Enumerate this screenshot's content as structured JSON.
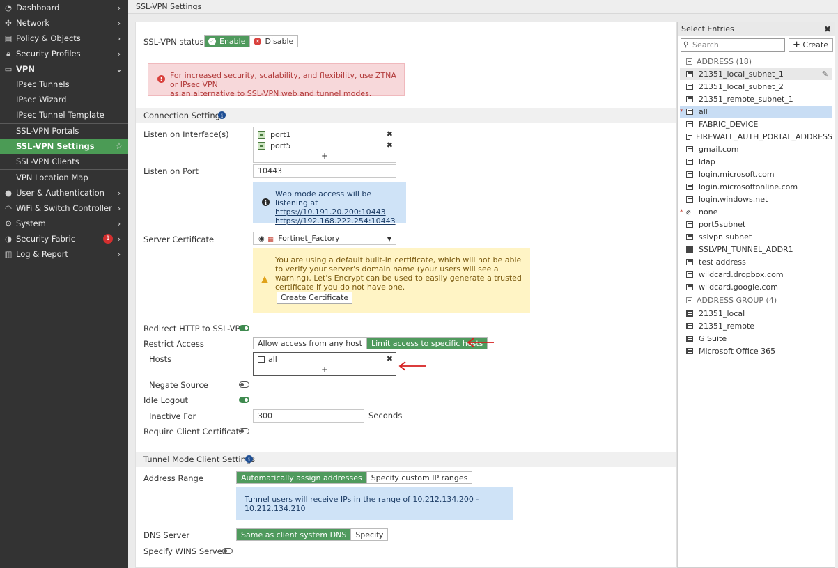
{
  "sidebar": {
    "items": [
      {
        "label": "Dashboard",
        "icon": "dashboard-icon",
        "chev": "›"
      },
      {
        "label": "Network",
        "icon": "network-icon",
        "chev": "›"
      },
      {
        "label": "Policy & Objects",
        "icon": "policy-icon",
        "chev": "›"
      },
      {
        "label": "Security Profiles",
        "icon": "lock-icon",
        "chev": "›"
      },
      {
        "label": "VPN",
        "icon": "laptop-icon",
        "chev": "⌄"
      },
      {
        "label": "User & Authentication",
        "icon": "user-icon",
        "chev": "›"
      },
      {
        "label": "WiFi & Switch Controller",
        "icon": "wifi-icon",
        "chev": "›"
      },
      {
        "label": "System",
        "icon": "gear-icon",
        "chev": "›"
      },
      {
        "label": "Security Fabric",
        "icon": "fabric-icon",
        "chev": "›",
        "badge": "1"
      },
      {
        "label": "Log & Report",
        "icon": "chart-icon",
        "chev": "›"
      }
    ],
    "vpn_sub": [
      "IPsec Tunnels",
      "IPsec Wizard",
      "IPsec Tunnel Template",
      "SSL-VPN Portals",
      "SSL-VPN Settings",
      "SSL-VPN Clients",
      "VPN Location Map"
    ]
  },
  "topbar": {
    "title": "SSL-VPN Settings"
  },
  "status": {
    "label": "SSL-VPN status",
    "enable": "Enable",
    "disable": "Disable"
  },
  "alert": {
    "pre": "For increased security, scalability, and flexibility, use ",
    "ztna": "ZTNA",
    "or": " or ",
    "ipsec": "IPsec VPN",
    "post": "as an alternative to SSL-VPN web and tunnel modes."
  },
  "connection": {
    "title": "Connection Settings",
    "listen_iface_label": "Listen on Interface(s)",
    "ports": [
      "port1",
      "port5"
    ],
    "listen_port_label": "Listen on Port",
    "listen_port_value": "10443",
    "web_info": "Web mode access will be listening at",
    "url1": "https://10.191.20.200:10443",
    "url2": "https://192.168.222.254:10443",
    "server_cert_label": "Server Certificate",
    "server_cert_value": "Fortinet_Factory",
    "cert_warning": "You are using a default built-in certificate, which will not be able to verify your server's domain name (your users will see a warning). Let's Encrypt can be used to easily generate a trusted certificate if you do not have one.",
    "create_cert": "Create Certificate",
    "redirect_label": "Redirect HTTP to SSL-VPN",
    "restrict_label": "Restrict Access",
    "restrict_any": "Allow access from any host",
    "restrict_specific": "Limit access to specific hosts",
    "hosts_label": "Hosts",
    "hosts_value": "all",
    "negate_label": "Negate Source",
    "idle_label": "Idle Logout",
    "inactive_label": "Inactive For",
    "inactive_value": "300",
    "seconds": "Seconds",
    "client_cert_label": "Require Client Certificate"
  },
  "tunnel": {
    "title": "Tunnel Mode Client Settings",
    "addr_label": "Address Range",
    "auto": "Automatically assign addresses",
    "custom": "Specify custom IP ranges",
    "range_info_1": "Tunnel users will receive IPs in the range of 10.212.134.200 -",
    "range_info_2": "10.212.134.210",
    "dns_label": "DNS Server",
    "dns_same": "Same as client system DNS",
    "dns_specify": "Specify",
    "wins_label": "Specify WINS Servers"
  },
  "panel": {
    "title": "Select Entries",
    "search_placeholder": "Search",
    "create": "Create",
    "address_header": "ADDRESS (18)",
    "addresses": [
      "21351_local_subnet_1",
      "21351_local_subnet_2",
      "21351_remote_subnet_1",
      "all",
      "FABRIC_DEVICE",
      "FIREWALL_AUTH_PORTAL_ADDRESS",
      "gmail.com",
      "ldap",
      "login.microsoft.com",
      "login.microsoftonline.com",
      "login.windows.net",
      "none",
      "port5subnet",
      "sslvpn subnet",
      "SSLVPN_TUNNEL_ADDR1",
      "test address",
      "wildcard.dropbox.com",
      "wildcard.google.com"
    ],
    "group_header": "ADDRESS GROUP (4)",
    "groups": [
      "21351_local",
      "21351_remote",
      "G Suite",
      "Microsoft Office 365"
    ]
  }
}
